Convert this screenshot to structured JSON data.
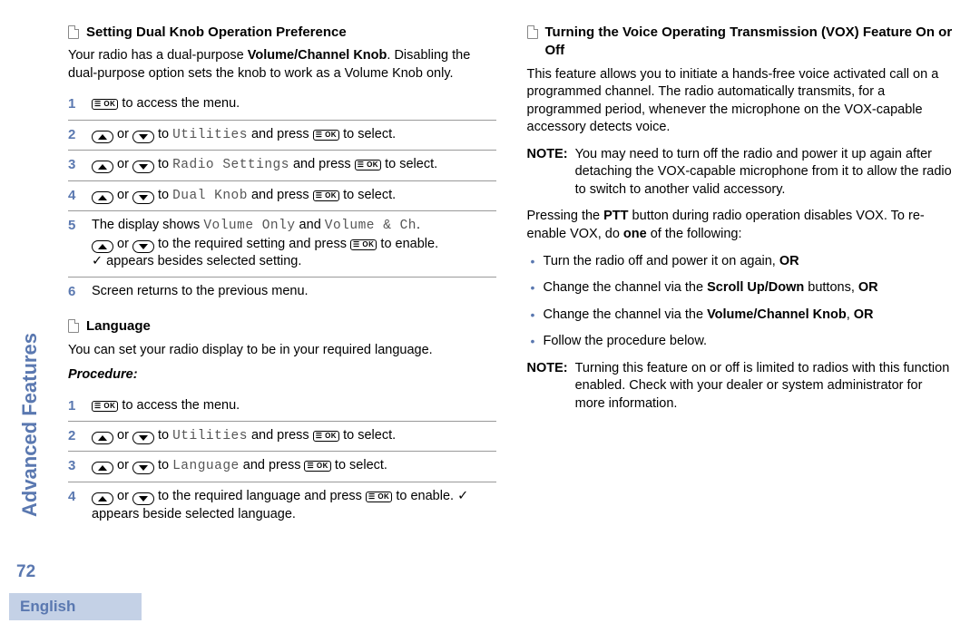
{
  "sidebar": {
    "section_title": "Advanced Features",
    "page_number": "72",
    "language_tab": "English"
  },
  "left": {
    "sec1": {
      "heading": "Setting Dual Knob Operation Preference",
      "intro_a": "Your radio has a dual-purpose ",
      "intro_b_bold": "Volume/Channel Knob",
      "intro_c": ". Disabling the dual-purpose option sets the knob to work as a Volume Knob only.",
      "steps": {
        "s1": " to access the menu.",
        "s2_a": " or ",
        "s2_b": " to ",
        "s2_menu": "Utilities",
        "s2_c": " and press ",
        "s2_d": " to select.",
        "s3_a": " or ",
        "s3_b": " to ",
        "s3_menu": "Radio Settings",
        "s3_c": " and press ",
        "s3_d": " to select.",
        "s4_a": " or ",
        "s4_b": " to ",
        "s4_menu": "Dual Knob",
        "s4_c": " and press ",
        "s4_d": " to select.",
        "s5_a": "The display shows ",
        "s5_m1": "Volume Only",
        "s5_mid": " and ",
        "s5_m2": "Volume & Ch",
        "s5_dot": ".",
        "s5_b": " or ",
        "s5_c": " to the required setting and press ",
        "s5_d": " to enable.",
        "s5_e": " appears besides selected setting.",
        "s6": "Screen returns to the previous menu."
      }
    },
    "sec2": {
      "heading": "Language",
      "intro": "You can set your radio display to be in your required language.",
      "procedure_label": "Procedure:",
      "steps": {
        "s1": " to access the menu.",
        "s2_a": " or ",
        "s2_b": " to ",
        "s2_menu": "Utilities",
        "s2_c": " and press ",
        "s2_d": " to select.",
        "s3_a": " or ",
        "s3_b": " to ",
        "s3_menu": "Language",
        "s3_c": " and press ",
        "s3_d": " to select.",
        "s4_a": " or ",
        "s4_b": " to the required language and press ",
        "s4_c": " to enable. ",
        "s4_d": " appears beside selected language."
      }
    }
  },
  "right": {
    "sec1": {
      "heading": "Turning the Voice Operating Transmission (VOX) Feature On or Off",
      "intro": "This feature allows you to initiate a hands-free voice activated call on a programmed channel. The radio automatically transmits, for a programmed period, whenever the microphone on the VOX-capable accessory detects voice.",
      "note1_label": "NOTE:",
      "note1_body": "You may need to turn off the radio and power it up again after detaching the VOX-capable microphone from it to allow the radio to switch to another valid accessory.",
      "p2_a": "Pressing the ",
      "p2_b_bold": "PTT",
      "p2_c": " button during radio operation disables VOX. To re-enable VOX, do ",
      "p2_d_bold": "one",
      "p2_e": " of the following:",
      "bullets": {
        "b1_a": "Turn the radio off and power it on again, ",
        "b1_b_bold": "OR",
        "b2_a": "Change the channel via the ",
        "b2_b_bold": "Scroll Up/Down",
        "b2_c": " buttons, ",
        "b2_d_bold": "OR",
        "b3_a": "Change the channel via the ",
        "b3_b_bold": "Volume/Channel Knob",
        "b3_c": ", ",
        "b3_d_bold": "OR",
        "b4": "Follow the procedure below."
      },
      "note2_label": "NOTE:",
      "note2_body": "Turning this feature on or off is limited to radios with this function enabled. Check with your dealer or system administrator for more information."
    }
  },
  "icons": {
    "ok_label": "☰ OK",
    "check": "✓"
  }
}
